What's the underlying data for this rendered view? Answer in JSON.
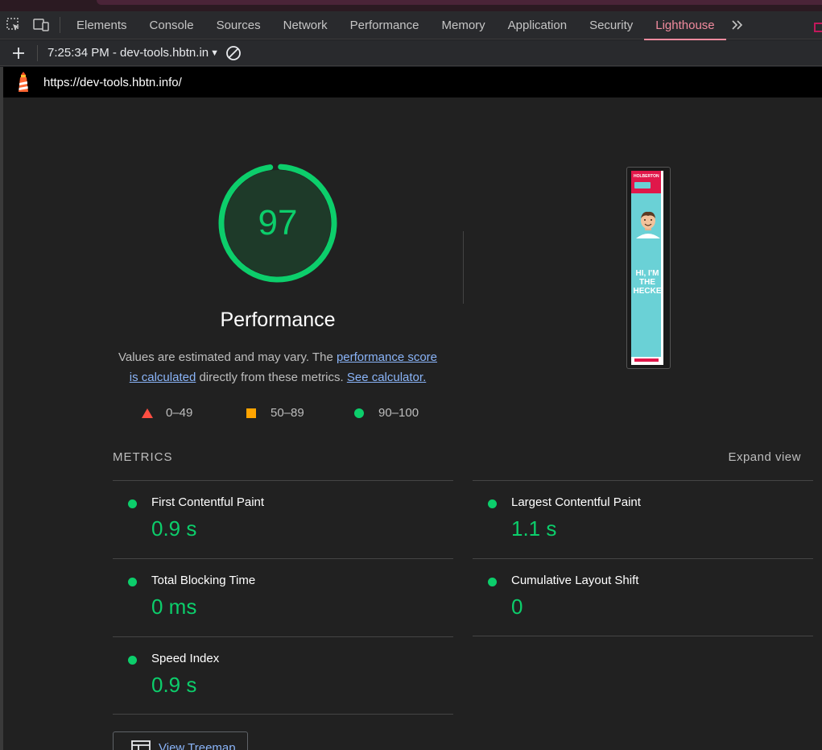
{
  "tabs": [
    {
      "label": "Elements",
      "active": false
    },
    {
      "label": "Console",
      "active": false
    },
    {
      "label": "Sources",
      "active": false
    },
    {
      "label": "Network",
      "active": false
    },
    {
      "label": "Performance",
      "active": false
    },
    {
      "label": "Memory",
      "active": false
    },
    {
      "label": "Application",
      "active": false
    },
    {
      "label": "Security",
      "active": false
    },
    {
      "label": "Lighthouse",
      "active": true
    }
  ],
  "toolbar": {
    "report_label": "7:25:34 PM - dev-tools.hbtn.in"
  },
  "url": "https://dev-tools.hbtn.info/",
  "gauge": {
    "score": "97",
    "score_value": 0.97,
    "title": "Performance",
    "color": "#0cce6b"
  },
  "description": {
    "pre": "Values are estimated and may vary. The ",
    "link1": "performance score is calculated",
    "mid": " directly from these metrics. ",
    "link2": "See calculator."
  },
  "legend": [
    {
      "range": "0–49",
      "color": "#ff4e42",
      "shape": "triangle"
    },
    {
      "range": "50–89",
      "color": "#ffa400",
      "shape": "square"
    },
    {
      "range": "90–100",
      "color": "#0cce6b",
      "shape": "circle"
    }
  ],
  "screenshot": {
    "brand": "HOLBERTON",
    "headline": "HI, I'M THE HECKE"
  },
  "metrics": {
    "heading": "METRICS",
    "expand_label": "Expand view",
    "items": [
      {
        "name": "First Contentful Paint",
        "value": "0.9 s"
      },
      {
        "name": "Largest Contentful Paint",
        "value": "1.1 s"
      },
      {
        "name": "Total Blocking Time",
        "value": "0 ms"
      },
      {
        "name": "Cumulative Layout Shift",
        "value": "0"
      },
      {
        "name": "Speed Index",
        "value": "0.9 s"
      }
    ]
  },
  "treemap_label": "View Treemap",
  "colors": {
    "accent_tab": "#f28b9e",
    "pass": "#0cce6b",
    "link": "#8ab4f8",
    "background": "#212121"
  }
}
